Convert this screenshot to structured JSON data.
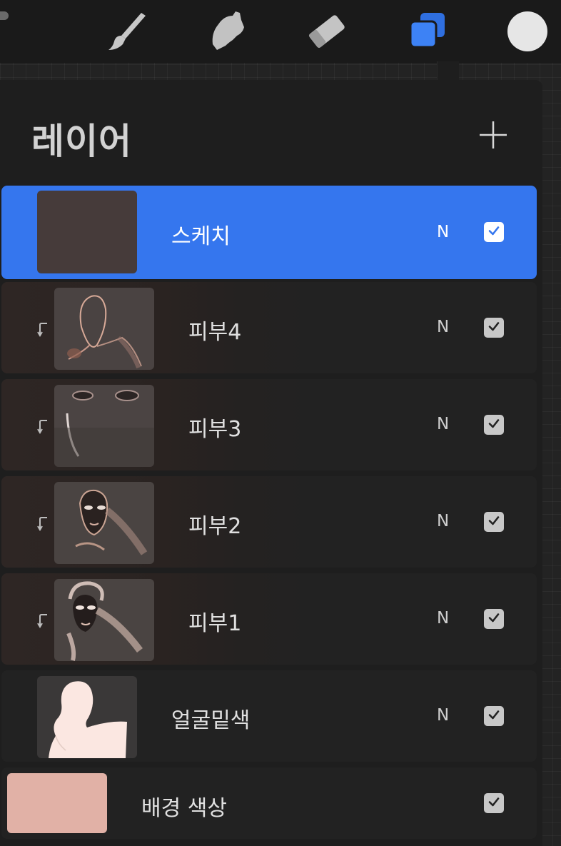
{
  "toolbar": {
    "tools": [
      {
        "name": "brush",
        "icon": "brush-icon"
      },
      {
        "name": "smudge",
        "icon": "smudge-icon"
      },
      {
        "name": "eraser",
        "icon": "eraser-icon"
      },
      {
        "name": "layers",
        "icon": "layers-icon",
        "active": true
      }
    ],
    "current_color": "#e6e6e6",
    "active_color": "#3576ee"
  },
  "panel": {
    "title": "레이어",
    "add_icon": "plus-icon"
  },
  "layers": [
    {
      "name": "스케치",
      "blend_mode": "N",
      "visible": true,
      "selected": true,
      "clipped": false
    },
    {
      "name": "피부4",
      "blend_mode": "N",
      "visible": true,
      "selected": false,
      "clipped": true
    },
    {
      "name": "피부3",
      "blend_mode": "N",
      "visible": true,
      "selected": false,
      "clipped": true
    },
    {
      "name": "피부2",
      "blend_mode": "N",
      "visible": true,
      "selected": false,
      "clipped": true
    },
    {
      "name": "피부1",
      "blend_mode": "N",
      "visible": true,
      "selected": false,
      "clipped": true
    },
    {
      "name": "얼굴밑색",
      "blend_mode": "N",
      "visible": true,
      "selected": false,
      "clipped": false
    }
  ],
  "background_layer": {
    "name": "배경 색상",
    "color": "#e1b1a6",
    "visible": true
  }
}
